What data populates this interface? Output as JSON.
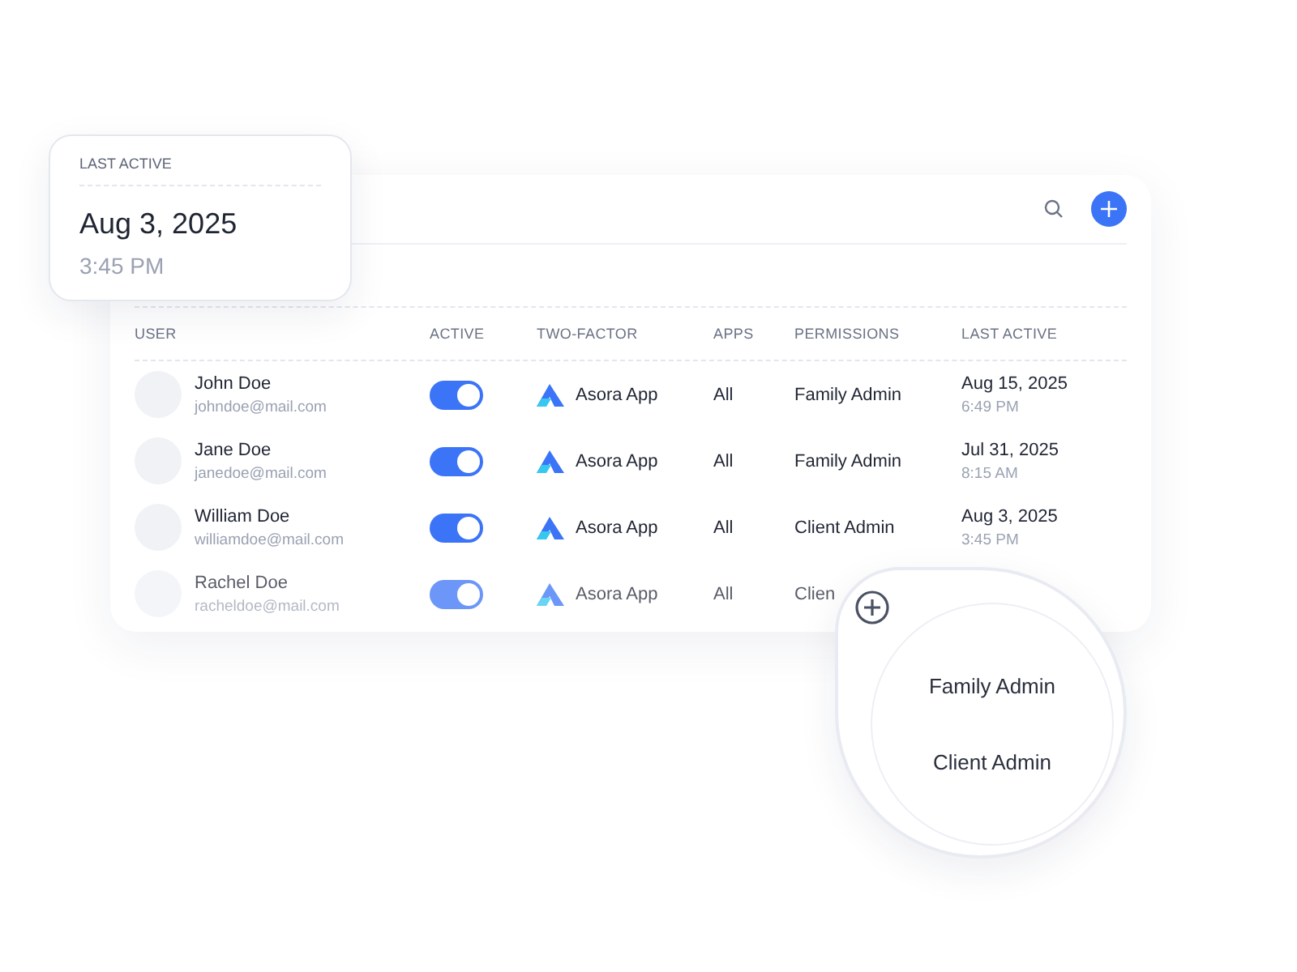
{
  "popover": {
    "label": "LAST ACTIVE",
    "date": "Aug 3, 2025",
    "time": "3:45 PM"
  },
  "table": {
    "columns": [
      "USER",
      "ACTIVE",
      "TWO-FACTOR",
      "APPS",
      "PERMISSIONS",
      "LAST ACTIVE"
    ],
    "rows": [
      {
        "name": "John Doe",
        "email": "johndoe@mail.com",
        "active": true,
        "app": "Asora App",
        "apps": "All",
        "permission": "Family Admin",
        "date": "Aug 15, 2025",
        "time": "6:49 PM"
      },
      {
        "name": "Jane Doe",
        "email": "janedoe@mail.com",
        "active": true,
        "app": "Asora App",
        "apps": "All",
        "permission": "Family Admin",
        "date": "Jul 31, 2025",
        "time": "8:15 AM"
      },
      {
        "name": "William Doe",
        "email": "williamdoe@mail.com",
        "active": true,
        "app": "Asora App",
        "apps": "All",
        "permission": "Client Admin",
        "date": "Aug 3, 2025",
        "time": "3:45 PM"
      },
      {
        "name": "Rachel Doe",
        "email": "racheldoe@mail.com",
        "active": true,
        "app": "Asora App",
        "apps": "All",
        "permission": "Clien"
      }
    ]
  },
  "lens": {
    "options": [
      "Family Admin",
      "Client Admin"
    ]
  }
}
